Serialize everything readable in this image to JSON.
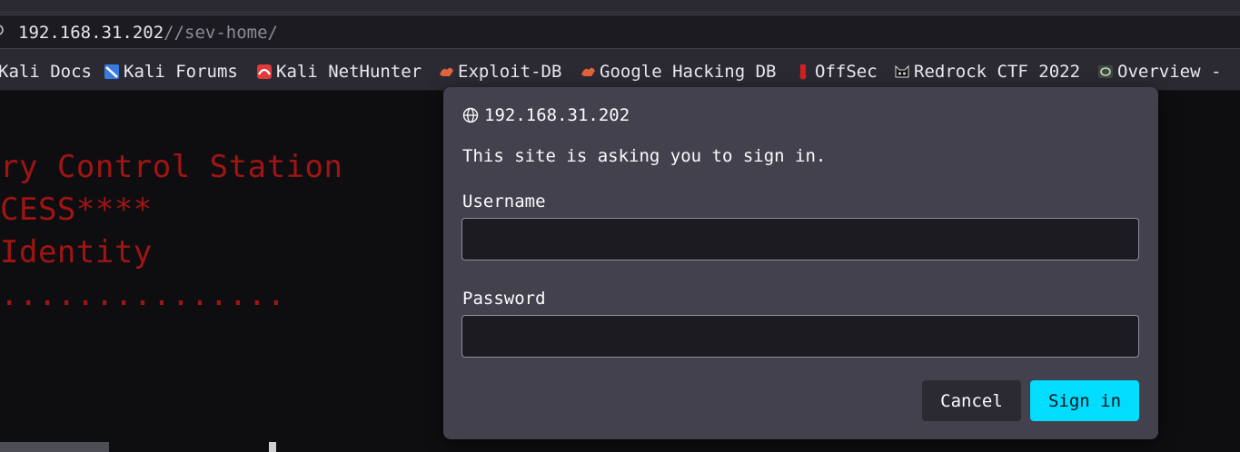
{
  "browser": {
    "url_host": "192.168.31.202",
    "url_path": "//sev-home/"
  },
  "bookmarks": [
    {
      "label": "Kali Docs",
      "icon": "kali-docs-icon"
    },
    {
      "label": "Kali Forums",
      "icon": "kali-forums-icon"
    },
    {
      "label": "Kali NetHunter",
      "icon": "nethunter-icon"
    },
    {
      "label": "Exploit-DB",
      "icon": "exploit-db-icon"
    },
    {
      "label": "Google Hacking DB",
      "icon": "ghdb-icon"
    },
    {
      "label": "OffSec",
      "icon": "offsec-icon"
    },
    {
      "label": "Redrock CTF 2022",
      "icon": "redrock-icon"
    },
    {
      "label": "Overview -",
      "icon": "overview-icon"
    }
  ],
  "page": {
    "lines": [
      "ry Control Station",
      "CESS****",
      "Identity",
      "..............."
    ],
    "text_color": "#a11414"
  },
  "dialog": {
    "host": "192.168.31.202",
    "message": "This site is asking you to sign in.",
    "username_label": "Username",
    "username_value": "",
    "password_label": "Password",
    "password_value": "",
    "cancel_label": "Cancel",
    "signin_label": "Sign in",
    "accent": "#00ddff"
  }
}
